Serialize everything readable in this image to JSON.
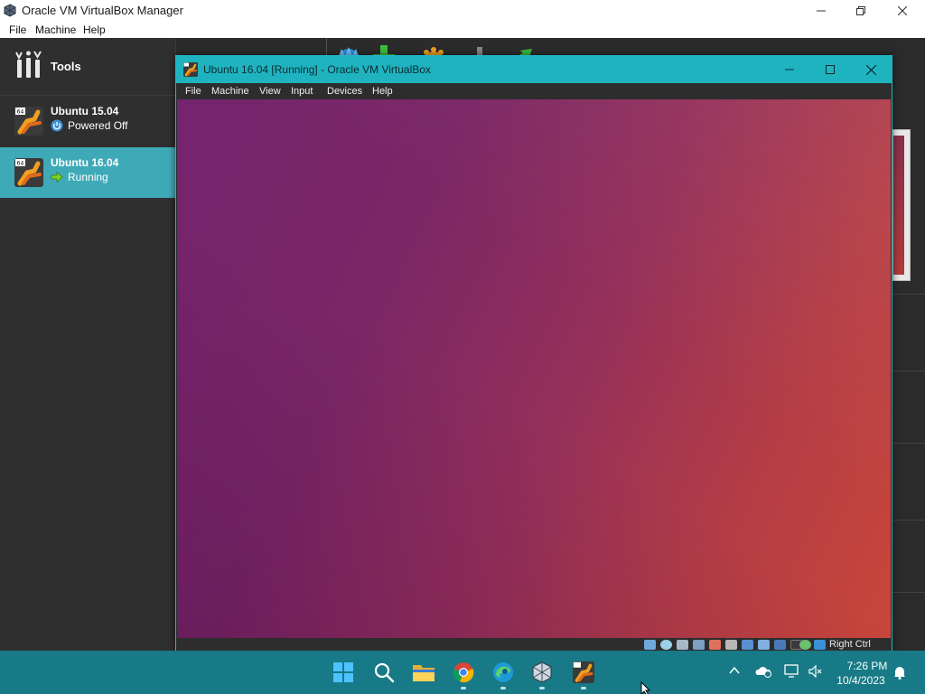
{
  "manager": {
    "title": "Oracle VM VirtualBox Manager",
    "menu": [
      "File",
      "Machine",
      "Help"
    ],
    "tools_label": "Tools",
    "vms": [
      {
        "name": "Ubuntu 15.04",
        "state": "Powered Off",
        "state_icon": "power-off-icon",
        "selected": false
      },
      {
        "name": "Ubuntu 16.04",
        "state": "Running",
        "state_icon": "running-arrow-icon",
        "selected": true
      }
    ],
    "toolbar": [
      {
        "icon": "settings-icon",
        "label": ""
      },
      {
        "icon": "discard-icon",
        "label": ""
      },
      {
        "icon": "show-icon",
        "label": ""
      }
    ]
  },
  "vm_window": {
    "title": "Ubuntu 16.04 [Running] - Oracle VM VirtualBox",
    "menu": [
      "File",
      "Machine",
      "View",
      "Input",
      "Devices",
      "Help"
    ],
    "host_key": "Right Ctrl",
    "status_icons": [
      "hard-disk-icon",
      "optical-drive-icon",
      "audio-icon",
      "network-icon",
      "usb-icon",
      "shared-folders-icon",
      "display-icon",
      "video-capture-icon",
      "graphics-icon",
      "mouse-integration-icon",
      "keyboard-capture-icon"
    ]
  },
  "taskbar": {
    "apps": [
      "start-icon",
      "search-icon",
      "file-explorer-icon",
      "chrome-icon",
      "edge-icon",
      "virtualbox-icon",
      "ubuntu-vm-icon"
    ],
    "time": "7:26 PM",
    "date": "10/4/2023"
  },
  "colors": {
    "accent": "#3faab7",
    "vm_title_bar": "#1fb3c0",
    "taskbar": "#177a86",
    "wallpaper_start": "#75246e",
    "wallpaper_end": "#c9463a"
  }
}
